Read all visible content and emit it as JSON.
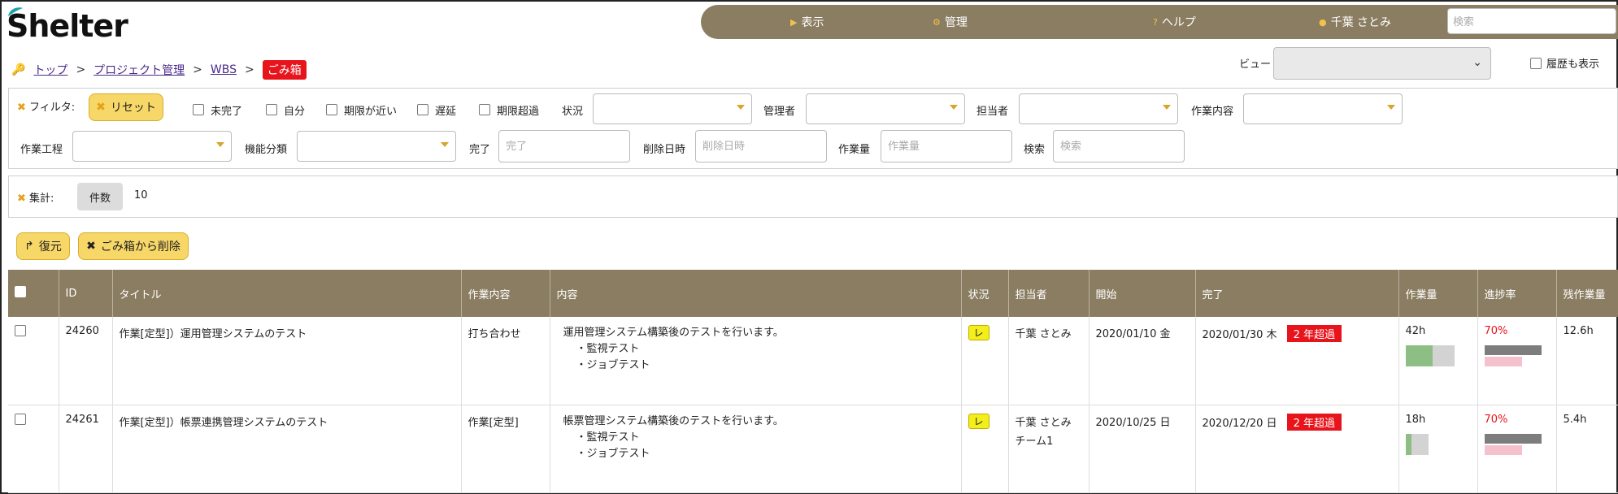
{
  "app": {
    "logo": "Shelter"
  },
  "topnav": {
    "items": [
      {
        "icon": "caret-right-icon",
        "label": "表示"
      },
      {
        "icon": "gear-icon",
        "label": "管理"
      },
      {
        "icon": "question-icon",
        "label": "ヘルプ"
      },
      {
        "icon": "user-icon",
        "label": "千葉 さとみ"
      }
    ],
    "search_placeholder": "検索"
  },
  "breadcrumb": {
    "items": [
      "トップ",
      "プロジェクト管理",
      "WBS"
    ],
    "current": "ごみ箱"
  },
  "view": {
    "label": "ビュー",
    "value": ""
  },
  "history_label": "履歴も表示",
  "filter": {
    "title": "フィルタ:",
    "reset": "リセット",
    "checks": [
      "未完了",
      "自分",
      "期限が近い",
      "遅延",
      "期限超過"
    ],
    "status": "状況",
    "manager": "管理者",
    "assignee": "担当者",
    "work_type": "作業内容",
    "process": "作業工程",
    "feature": "機能分類",
    "done": {
      "label": "完了",
      "placeholder": "完了"
    },
    "deleted": {
      "label": "削除日時",
      "placeholder": "削除日時"
    },
    "effort": {
      "label": "作業量",
      "placeholder": "作業量"
    },
    "search": {
      "label": "検索",
      "placeholder": "検索"
    }
  },
  "summary": {
    "title": "集計:",
    "count_label": "件数",
    "count_value": "10"
  },
  "actions": {
    "restore": "復元",
    "delete": "ごみ箱から削除"
  },
  "table": {
    "headers": [
      "ID",
      "タイトル",
      "作業内容",
      "内容",
      "状況",
      "担当者",
      "開始",
      "完了",
      "作業量",
      "進捗率",
      "残作業量"
    ],
    "rows": [
      {
        "id": "24260",
        "title": "作業[定型]）運用管理システムのテスト",
        "work": "打ち合わせ",
        "desc": [
          "運用管理システム構築後のテストを行います。",
          "・監視テスト",
          "・ジョブテスト"
        ],
        "status": "レ",
        "assignee": [
          "千葉 さとみ"
        ],
        "start": "2020/01/10 金",
        "end": "2020/01/30 木",
        "over": "2 年超過",
        "effort": "42h",
        "effort_fill": 0.55,
        "progress": "70%",
        "progress_fill": 0.7,
        "remaining": "12.6h"
      },
      {
        "id": "24261",
        "title": "作業[定型]）帳票連携管理システムのテスト",
        "work": "作業[定型]",
        "desc": [
          "帳票管理システム構築後のテストを行います。",
          "・監視テスト",
          "・ジョブテスト"
        ],
        "status": "レ",
        "assignee": [
          "千葉 さとみ",
          "チーム1"
        ],
        "start": "2020/10/25 日",
        "end": "2020/12/20 日",
        "over": "2 年超過",
        "effort": "18h",
        "effort_fill": 0.25,
        "progress": "70%",
        "progress_fill": 0.7,
        "remaining": "5.4h"
      }
    ]
  }
}
